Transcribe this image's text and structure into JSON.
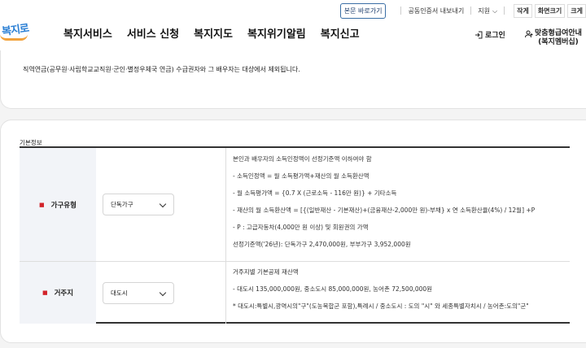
{
  "header": {
    "logo_text": "복지로",
    "gnb": [
      "복지서비스",
      "서비스 신청",
      "복지지도",
      "복지위기알림",
      "복지신고"
    ],
    "util": {
      "skip": "본문 바로가기",
      "cert": "공동인증서 내보내기",
      "support": "지원",
      "zoom_out": "작게",
      "zoom_label": "화면크기",
      "zoom_in": "크게"
    },
    "login": "로그인",
    "member_line1": "맞춤형급여안내",
    "member_line2": "(복지멤버십)"
  },
  "notice": "직역연금(공무원·사립학교교직원·군인·별정우체국 연금) 수급권자와 그 배우자는 대상에서 제외됩니다.",
  "section_title": "기본정보",
  "rows": [
    {
      "label": "가구유형",
      "select_value": "단독가구",
      "desc": [
        "본인과 배우자의 소득인정액이 선정기준액 이하여야 함",
        "- 소득인정액 = 월 소득평가액+재산의 월 소득환산액",
        "- 월 소득평가액 = {0.7 X (근로소득 - 116만 원)} + 기타소득",
        "- 재산의 월 소득환산액 = [{(일반재산 - 기본재산)+(금융재산-2,000만 원)-부채} x 연 소득환산율(4%) / 12월] +P",
        "- P : 고급자동차(4,000만 원 이상) 및 회원권의 가액",
        "선정기준액('26년): 단독가구 2,470,000원, 부부가구 3,952,000원"
      ]
    },
    {
      "label": "거주지",
      "select_value": "대도시",
      "desc": [
        "거주지별 기본공제 재산액",
        "- 대도시 135,000,000원, 중소도시 85,000,000원, 농어촌 72,500,000원",
        "* 대도시:특별시,광역시의\"구\"(도농복합군 포함),특례시 / 중소도시 : 도의 \"시\" 와 세종특별자치시 / 농어촌:도의\"군\""
      ]
    }
  ]
}
